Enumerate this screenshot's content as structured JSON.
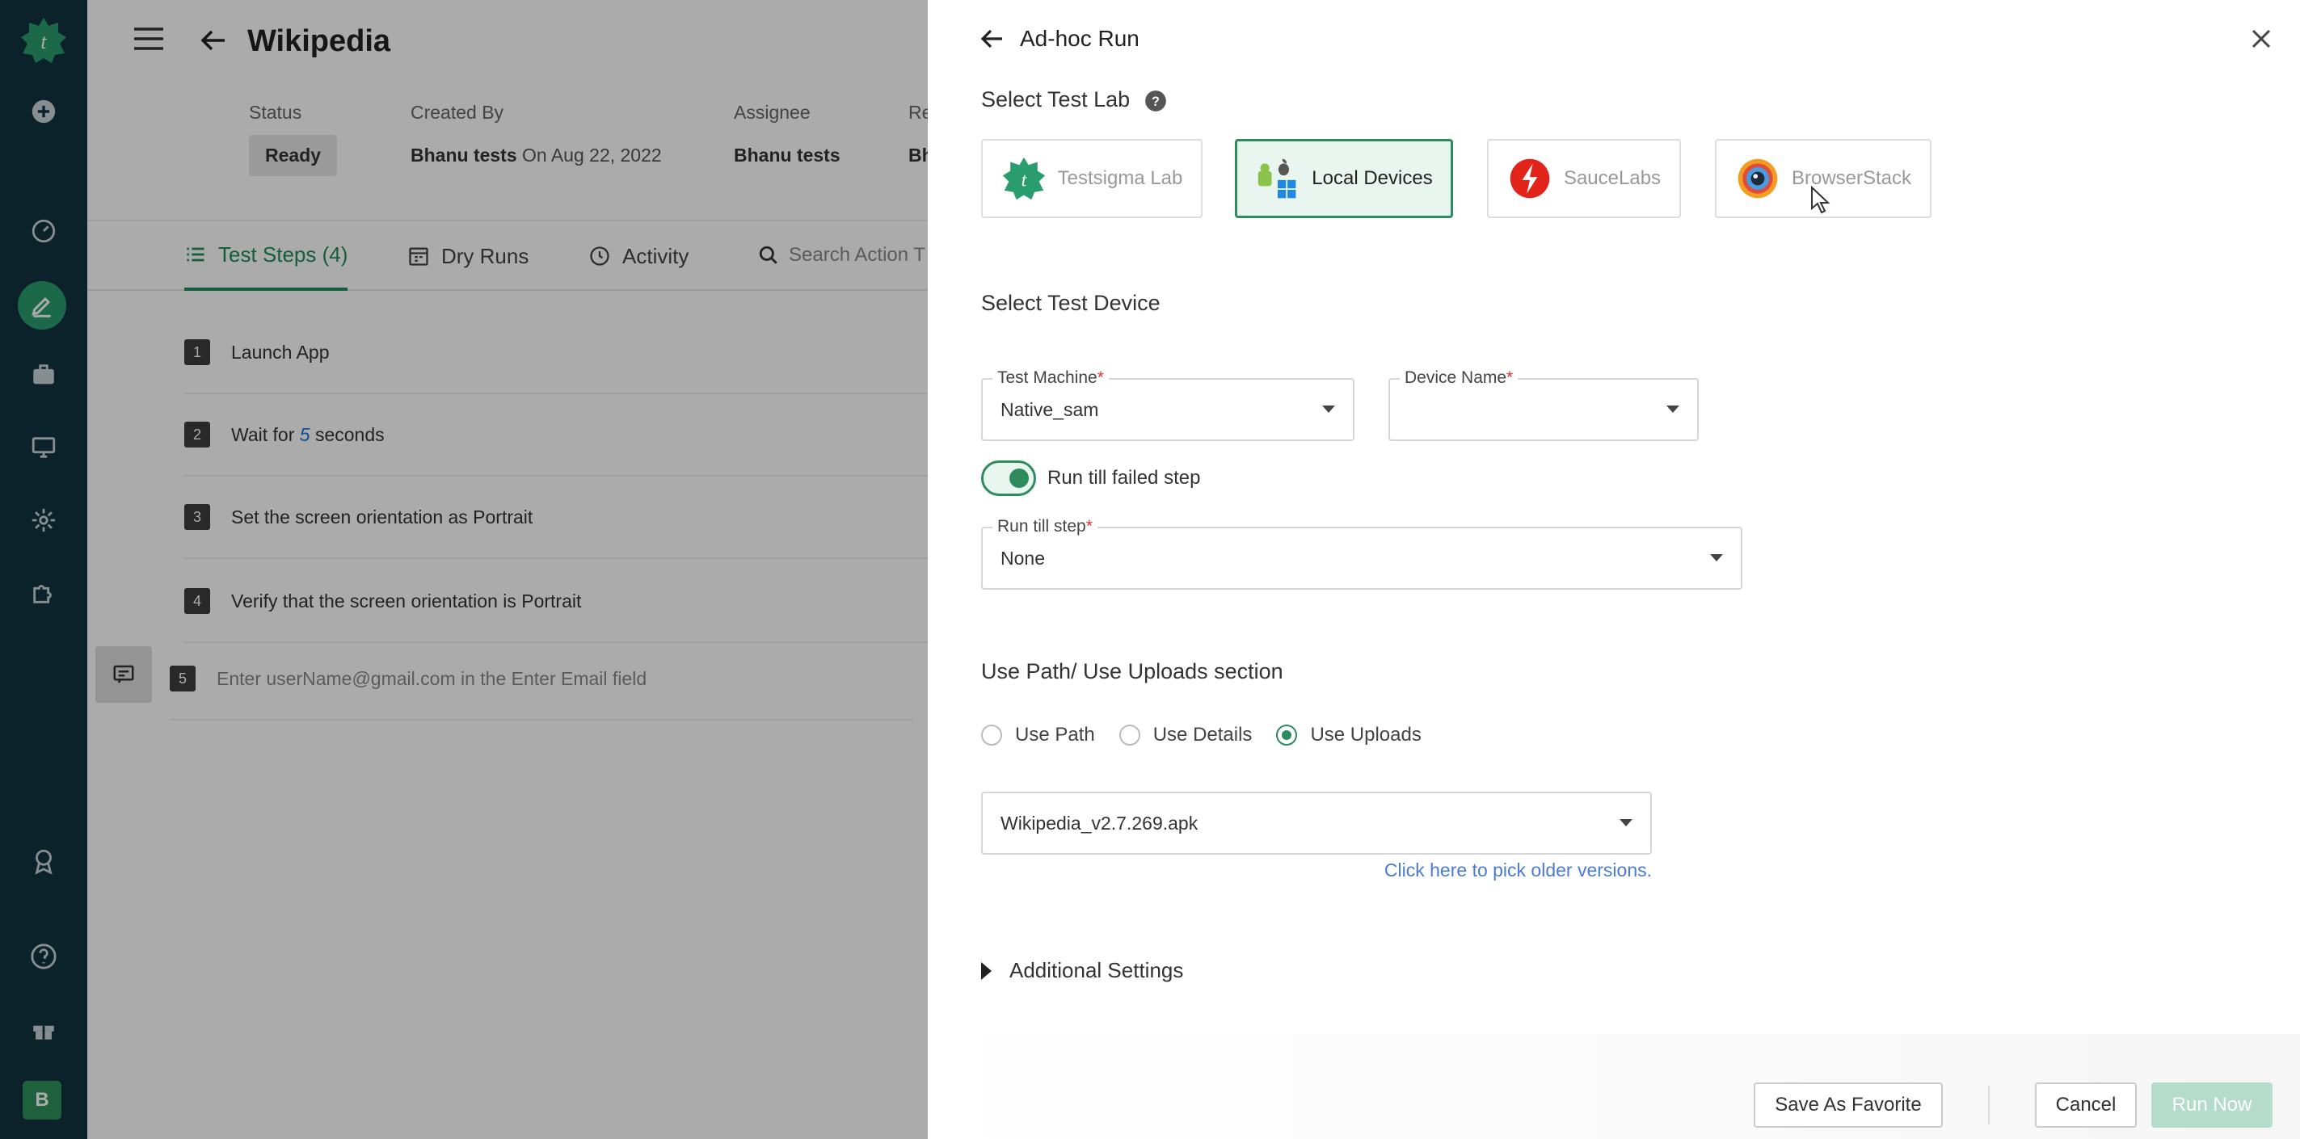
{
  "page": {
    "title": "Wikipedia",
    "meta": {
      "status_label": "Status",
      "status_value": "Ready",
      "created_by_label": "Created By",
      "created_by_value": "Bhanu tests",
      "created_on": "On Aug 22, 2022",
      "assignee_label": "Assignee",
      "assignee_value": "Bhanu tests",
      "reviewer_label": "Re",
      "reviewer_value": "Bh"
    },
    "tabs": [
      {
        "label": "Test Steps (4)"
      },
      {
        "label": "Dry Runs"
      },
      {
        "label": "Activity"
      }
    ],
    "search_placeholder": "Search Action T",
    "steps": [
      {
        "num": "1",
        "text": "Launch App"
      },
      {
        "num": "2",
        "pre": "Wait for",
        "value": "5",
        "post": "seconds"
      },
      {
        "num": "3",
        "text": "Set the screen orientation as Portrait"
      },
      {
        "num": "4",
        "text": "Verify that the screen orientation is Portrait"
      },
      {
        "num": "5",
        "text": "Enter userName@gmail.com in the Enter Email field"
      }
    ]
  },
  "drawer": {
    "title": "Ad-hoc Run",
    "select_lab_label": "Select Test Lab",
    "labs": [
      {
        "label": "Testsigma Lab",
        "icon": "testsigma-icon",
        "selected": false
      },
      {
        "label": "Local Devices",
        "icon": "local-devices-icon",
        "selected": true
      },
      {
        "label": "SauceLabs",
        "icon": "saucelabs-icon",
        "selected": false
      },
      {
        "label": "BrowserStack",
        "icon": "browserstack-icon",
        "selected": false
      }
    ],
    "select_device_label": "Select Test Device",
    "test_machine": {
      "label": "Test Machine",
      "required": "*",
      "value": "Native_sam"
    },
    "device_name": {
      "label": "Device Name",
      "required": "*",
      "value": ""
    },
    "run_till_failed_label": "Run till failed step",
    "run_till_failed_on": true,
    "run_till_step": {
      "label": "Run till step",
      "required": "*",
      "value": "None"
    },
    "uploads_section_label": "Use Path/ Use Uploads section",
    "radios": [
      {
        "label": "Use Path",
        "selected": false
      },
      {
        "label": "Use Details",
        "selected": false
      },
      {
        "label": "Use Uploads",
        "selected": true
      }
    ],
    "upload_file": {
      "value": "Wikipedia_v2.7.269.apk"
    },
    "older_versions_link": "Click here to pick older versions.",
    "additional_settings_label": "Additional Settings",
    "buttons": {
      "save_favorite": "Save As Favorite",
      "cancel": "Cancel",
      "run_now": "Run Now"
    }
  },
  "rail": {
    "avatar_initial": "B"
  },
  "colors": {
    "rail_bg": "#13343f",
    "accent": "#2e8b5e",
    "link": "#4a7bd5"
  }
}
